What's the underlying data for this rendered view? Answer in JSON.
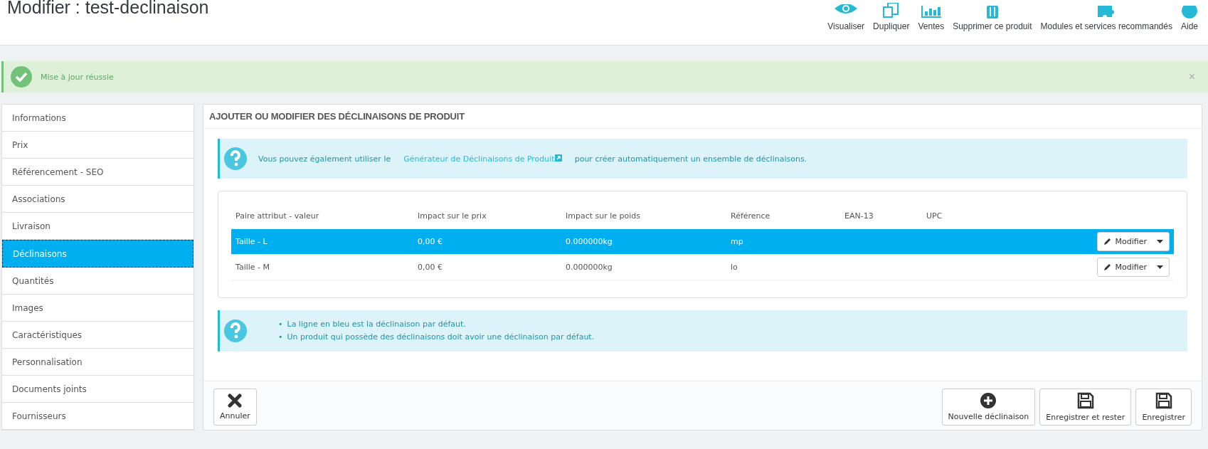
{
  "header": {
    "title": "Modifier : test-declinaison",
    "toolbar": [
      {
        "label": "Visualiser"
      },
      {
        "label": "Dupliquer"
      },
      {
        "label": "Ventes"
      },
      {
        "label": "Supprimer ce produit"
      },
      {
        "label": "Modules et services recommandés"
      },
      {
        "label": "Aide"
      }
    ]
  },
  "alert": {
    "message": "Mise à jour réussie",
    "close": "×"
  },
  "sidebar": {
    "items": [
      {
        "label": "Informations",
        "selected": false
      },
      {
        "label": "Prix",
        "selected": false
      },
      {
        "label": "Référencement - SEO",
        "selected": false
      },
      {
        "label": "Associations",
        "selected": false
      },
      {
        "label": "Livraison",
        "selected": false
      },
      {
        "label": "Déclinaisons",
        "selected": true
      },
      {
        "label": "Quantités",
        "selected": false
      },
      {
        "label": "Images",
        "selected": false
      },
      {
        "label": "Caractéristiques",
        "selected": false
      },
      {
        "label": "Personnalisation",
        "selected": false
      },
      {
        "label": "Documents joints",
        "selected": false
      },
      {
        "label": "Fournisseurs",
        "selected": false
      }
    ]
  },
  "panel": {
    "title": "AJOUTER OU MODIFIER DES DÉCLINAISONS DE PRODUIT",
    "info": {
      "before": "Vous pouvez également utiliser le",
      "link": "Générateur de Déclinaisons de Produit",
      "after": "pour créer automatiquement un ensemble de déclinaisons."
    },
    "table": {
      "columns": [
        "Paire attribut - valeur",
        "Impact sur le prix",
        "Impact sur le poids",
        "Référence",
        "EAN-13",
        "UPC"
      ],
      "rows": [
        {
          "cells": [
            "Taille - L",
            "0,00 €",
            "0.000000kg",
            "mp",
            "",
            ""
          ],
          "selected": true,
          "action": "Modifier"
        },
        {
          "cells": [
            "Taille - M",
            "0,00 €",
            "0.000000kg",
            "lo",
            "",
            ""
          ],
          "selected": false,
          "action": "Modifier"
        }
      ]
    },
    "notes": [
      {
        "bullet": "•",
        "text": "La ligne en bleu est la déclinaison par défaut."
      },
      {
        "bullet": "•",
        "text": "Un produit qui possède des déclinaisons doit avoir une déclinaison par défaut."
      }
    ],
    "footer": {
      "left": [
        {
          "label": "Annuler"
        }
      ],
      "right": [
        {
          "label": "Nouvelle déclinaison"
        },
        {
          "label": "Enregistrer et rester"
        },
        {
          "label": "Enregistrer"
        }
      ]
    }
  }
}
